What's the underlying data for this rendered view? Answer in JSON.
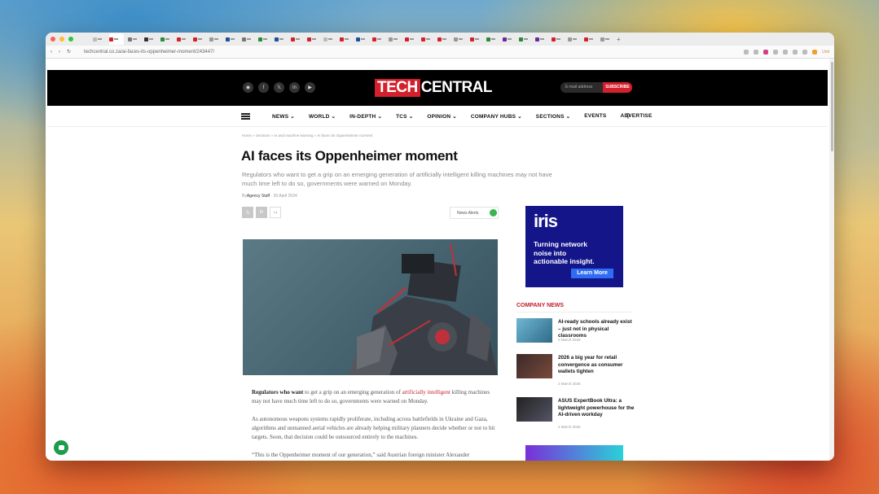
{
  "browser": {
    "url": "techcentral.co.za/ai-faces-its-oppenheimer-moment/243447/",
    "profile_label": "Unit"
  },
  "site": {
    "logo_part1": "TECH",
    "logo_part2": "CENTRAL",
    "social_icons": [
      "whatsapp-icon",
      "facebook-icon",
      "x-icon",
      "linkedin-icon",
      "youtube-icon"
    ],
    "email_placeholder": "E-mail address",
    "subscribe_label": "SUBSCRIBE",
    "nav": [
      "NEWS ⌄",
      "WORLD ⌄",
      "IN-DEPTH ⌄",
      "TCS ⌄",
      "OPINION ⌄",
      "COMPANY HUBS ⌄",
      "SECTIONS ⌄",
      "EVENTS",
      "ADVERTISE"
    ],
    "brand_color": "#d4202c"
  },
  "article": {
    "breadcrumb": "Home » Sections » AI and machine learning » AI faces its Oppenheimer moment",
    "title": "AI faces its Oppenheimer moment",
    "excerpt": "Regulators who want to get a grip on an emerging generation of artificially intelligent killing machines may not have much time left to do so, governments were warned on Monday.",
    "byline_prefix": "By",
    "author": "Agency Staff",
    "date": "30 April 2024",
    "share_icons": [
      "x-icon",
      "linkedin-icon",
      "share-icon"
    ],
    "news_alerts_label": "News Alerts",
    "body": {
      "p1_lead": "Regulators who want",
      "p1_a": " to get a grip on an emerging generation of ",
      "p1_link": "artificially intelligent",
      "p1_b": " killing machines may not have much time left to do so, governments were warned on Monday.",
      "p2": "As autonomous weapons systems rapidly proliferate, including across battlefields in Ukraine and Gaza, algorithms and unmanned aerial vehicles are already helping military planners decide whether or not to hit targets. Soon, that decision could be outsourced entirely to the machines.",
      "p3": "“This is the Oppenheimer moment of our generation,” said Austrian foreign minister Alexander"
    }
  },
  "sidebar": {
    "ad_logo": "iris",
    "ad_tagline_1": "Turning network",
    "ad_tagline_2": "noise into",
    "ad_tagline_3": "actionable insight.",
    "ad_button": "Learn More",
    "company_news_heading": "COMPANY NEWS",
    "company_news": [
      {
        "title": "AI-ready schools already exist – just not in physical classrooms",
        "date": "2 March 2026"
      },
      {
        "title": "2026 a big year for retail convergence as consumer wallets tighten",
        "date": "2 March 2026"
      },
      {
        "title": "ASUS ExpertBook Ultra: a lightweight powerhouse for the AI-driven workday",
        "date": "2 March 2026"
      }
    ]
  }
}
